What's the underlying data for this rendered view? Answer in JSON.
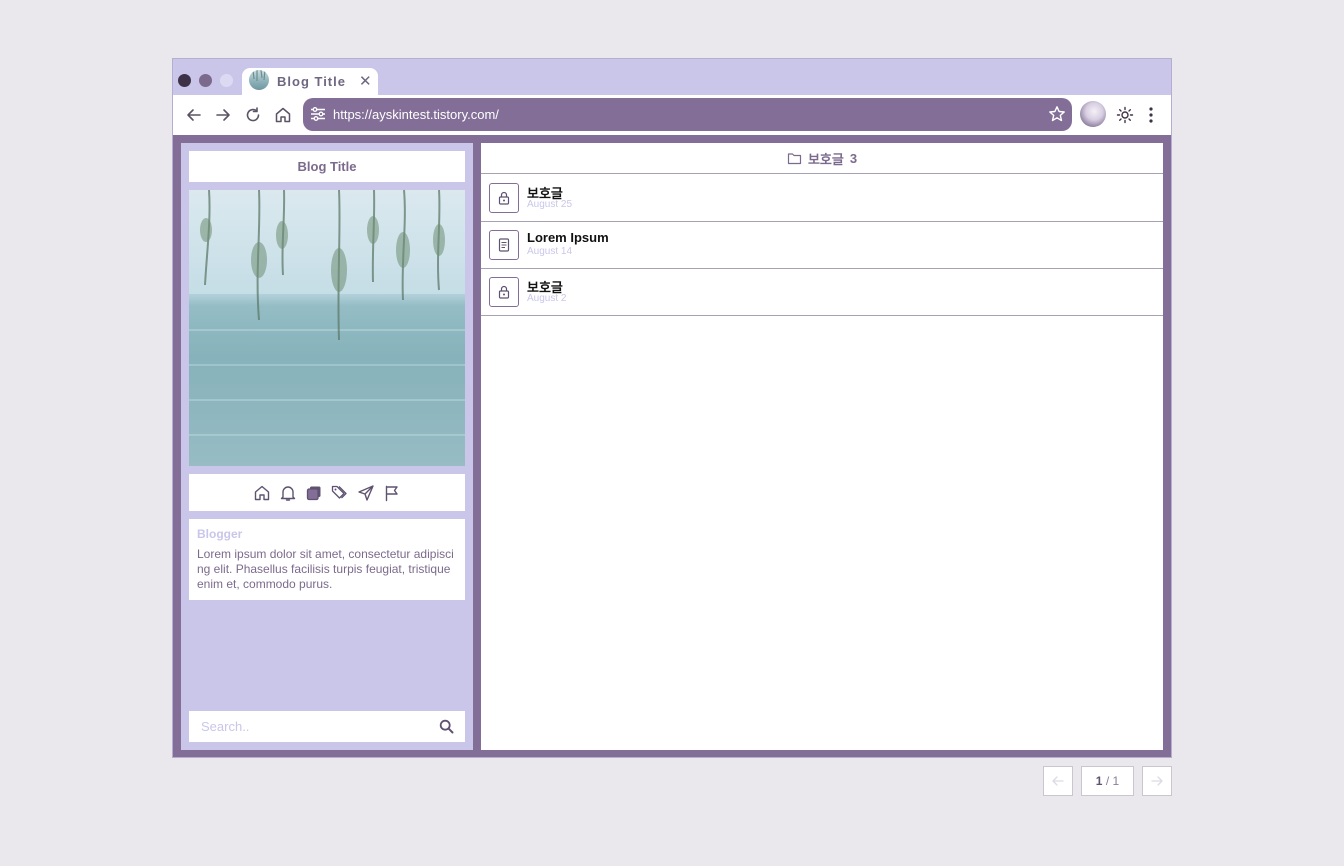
{
  "browser": {
    "tab_title": "Blog Title",
    "tab_close": "✕",
    "url": "https://ayskintest.tistory.com/"
  },
  "sidebar": {
    "title": "Blog Title",
    "icons": [
      "home-icon",
      "bell-icon",
      "stack-icon",
      "tags-icon",
      "send-icon",
      "flag-icon"
    ],
    "about": {
      "name": "Blogger",
      "description": "Lorem ipsum dolor sit amet, consectetur adipiscing elit. Phasellus facilisis turpis feugiat, tristique enim et, commodo purus."
    },
    "search": {
      "placeholder": "Search.."
    }
  },
  "main": {
    "category": "보호글",
    "count": "3",
    "posts": [
      {
        "title": "보호글",
        "date": "August 25",
        "icon": "lock-icon"
      },
      {
        "title": "Lorem Ipsum",
        "date": "August 14",
        "icon": "document-icon"
      },
      {
        "title": "보호글",
        "date": "August 2",
        "icon": "lock-icon"
      }
    ]
  },
  "pagination": {
    "current": "1",
    "separator": " / ",
    "total": "1"
  },
  "colors": {
    "accent": "#836e97",
    "light": "#c9c6e9",
    "background": "#eae8ec"
  }
}
